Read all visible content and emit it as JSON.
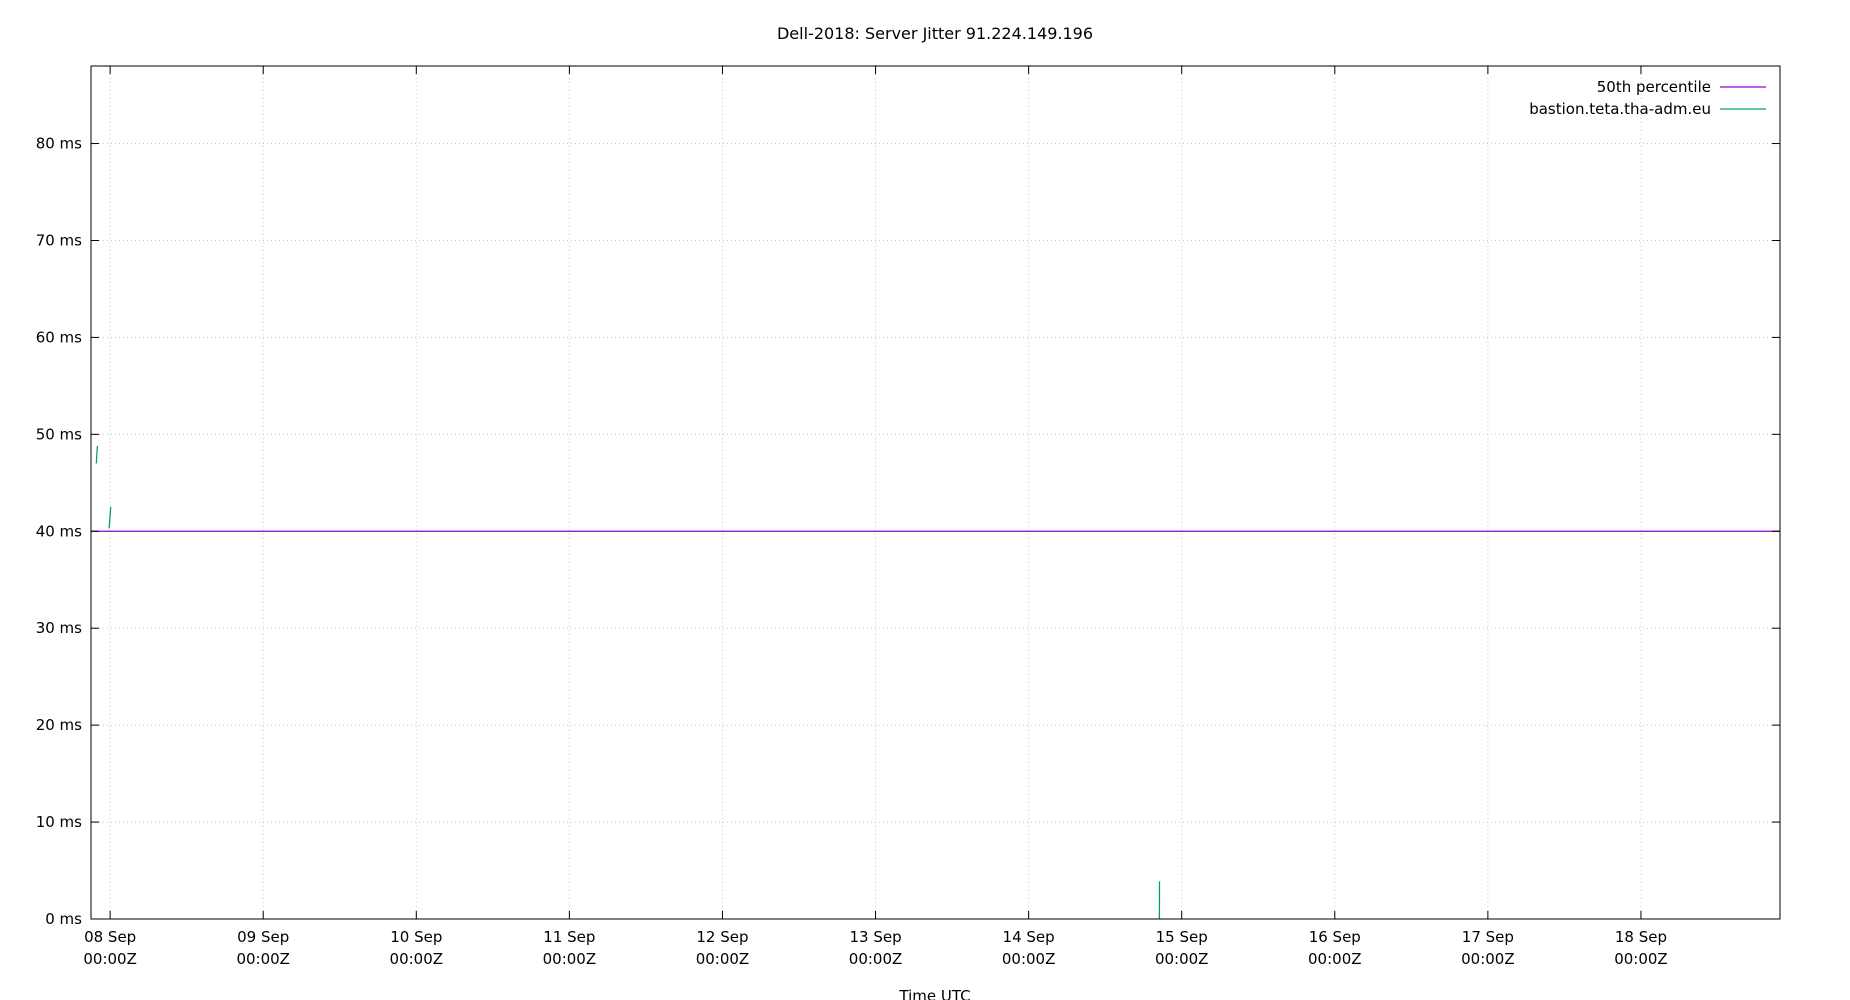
{
  "chart_data": {
    "type": "line",
    "title": "Dell-2018: Server Jitter 91.224.149.196",
    "xlabel": "Time UTC",
    "ylabel": "",
    "ylim": [
      0,
      88
    ],
    "xlim": [
      "2024-09-07T21:00:00Z",
      "2024-09-18T21:48:00Z"
    ],
    "y_ticks": [
      0,
      10,
      20,
      30,
      40,
      50,
      60,
      70,
      80
    ],
    "y_tick_labels": [
      "0 ms",
      "10 ms",
      "20 ms",
      "30 ms",
      "40 ms",
      "50 ms",
      "60 ms",
      "70 ms",
      "80 ms"
    ],
    "x_ticks": [
      {
        "x": "2024-09-08T00:00:00Z",
        "line1": "08 Sep",
        "line2": "00:00Z"
      },
      {
        "x": "2024-09-09T00:00:00Z",
        "line1": "09 Sep",
        "line2": "00:00Z"
      },
      {
        "x": "2024-09-10T00:00:00Z",
        "line1": "10 Sep",
        "line2": "00:00Z"
      },
      {
        "x": "2024-09-11T00:00:00Z",
        "line1": "11 Sep",
        "line2": "00:00Z"
      },
      {
        "x": "2024-09-12T00:00:00Z",
        "line1": "12 Sep",
        "line2": "00:00Z"
      },
      {
        "x": "2024-09-13T00:00:00Z",
        "line1": "13 Sep",
        "line2": "00:00Z"
      },
      {
        "x": "2024-09-14T00:00:00Z",
        "line1": "14 Sep",
        "line2": "00:00Z"
      },
      {
        "x": "2024-09-15T00:00:00Z",
        "line1": "15 Sep",
        "line2": "00:00Z"
      },
      {
        "x": "2024-09-16T00:00:00Z",
        "line1": "16 Sep",
        "line2": "00:00Z"
      },
      {
        "x": "2024-09-17T00:00:00Z",
        "line1": "17 Sep",
        "line2": "00:00Z"
      },
      {
        "x": "2024-09-18T00:00:00Z",
        "line1": "18 Sep",
        "line2": "00:00Z"
      }
    ],
    "grid": true,
    "legend_position": "top-right",
    "series": [
      {
        "name": "50th percentile",
        "color": "#9400d3",
        "kind": "hline",
        "y": 40
      },
      {
        "name": "bastion.teta.tha-adm.eu",
        "color": "#009e73",
        "kind": "segments",
        "segments": [
          [
            {
              "x": "2024-09-07T21:50:00Z",
              "y": 47.0
            },
            {
              "x": "2024-09-07T22:00:00Z",
              "y": 48.8
            }
          ],
          [
            {
              "x": "2024-09-07T23:50:00Z",
              "y": 40.3
            },
            {
              "x": "2024-09-08T00:05:00Z",
              "y": 42.5
            }
          ],
          [
            {
              "x": "2024-09-14T20:30:00Z",
              "y": 0.0
            },
            {
              "x": "2024-09-14T20:31:00Z",
              "y": 3.9
            }
          ]
        ]
      }
    ]
  }
}
